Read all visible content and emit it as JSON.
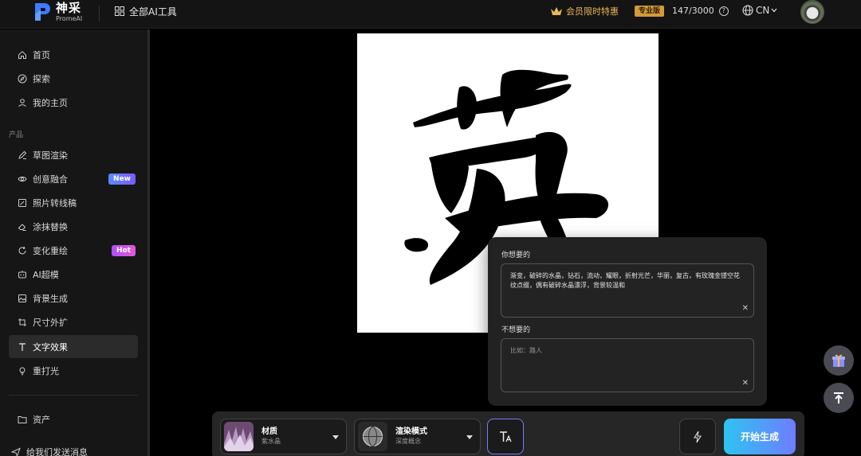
{
  "header": {
    "logo_cn": "神采",
    "logo_en": "PromeAI",
    "all_tools_label": "全部AI工具",
    "vip_label": "会员限时特惠",
    "plan_badge": "专业版",
    "credits": "147/3000",
    "language": "CN"
  },
  "sidebar": {
    "items_top": [
      {
        "label": "首页",
        "icon": "home-icon"
      },
      {
        "label": "探索",
        "icon": "compass-icon"
      },
      {
        "label": "我的主页",
        "icon": "user-icon"
      }
    ],
    "section_label": "产品",
    "products": [
      {
        "label": "草图渲染",
        "icon": "sketch-icon"
      },
      {
        "label": "创意融合",
        "icon": "eye-icon",
        "tag": "New"
      },
      {
        "label": "照片转线稿",
        "icon": "image-edit-icon"
      },
      {
        "label": "涂抹替换",
        "icon": "eraser-icon"
      },
      {
        "label": "变化重绘",
        "icon": "refresh-icon",
        "tag": "Hot"
      },
      {
        "label": "AI超模",
        "icon": "robot-icon"
      },
      {
        "label": "背景生成",
        "icon": "background-icon"
      },
      {
        "label": "尺寸外扩",
        "icon": "crop-icon"
      },
      {
        "label": "文字效果",
        "icon": "text-icon"
      },
      {
        "label": "重打光",
        "icon": "light-icon"
      }
    ],
    "assets_label": "资产",
    "feedback_label": "给我们发送消息"
  },
  "prompt_panel": {
    "positive_label": "你想要的",
    "positive_text": "渐变，破碎的水晶，钻石，流动，耀眼，折射光芒，华丽，复古，有玫瑰金镂空花纹点缀，偶有破碎水晶漂浮，背景较温和",
    "negative_label": "不想要的",
    "negative_placeholder": "比如：路人"
  },
  "toolbar": {
    "material_title": "材质",
    "material_value": "紫水晶",
    "render_title": "渲染模式",
    "render_value": "深度概念",
    "generate_label": "开始生成"
  },
  "colors": {
    "accent_gradient_start": "#2ec4f0",
    "accent_gradient_end": "#6d7dff",
    "vip_gold": "#e7b75a",
    "tag_new": "#5a8cff",
    "tag_hot": "#c24cff"
  }
}
